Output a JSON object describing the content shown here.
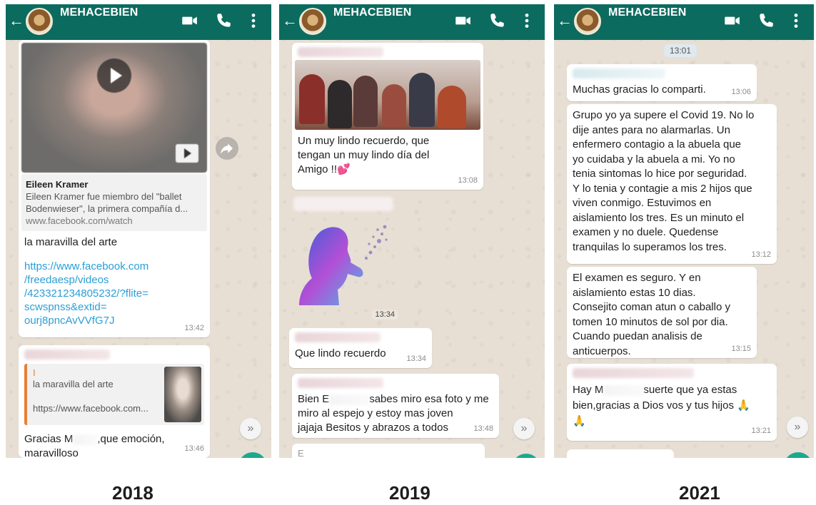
{
  "app": {
    "chat_title": "MEHACEBIEN"
  },
  "icons": {
    "back": "arrow-left-icon",
    "video": "video-call-icon",
    "call": "phone-icon",
    "menu": "more-vert-icon",
    "scroll": "double-chevron-down-icon"
  },
  "colors": {
    "header": "#0c6b5f",
    "chat_bg": "#e7dfd4",
    "link": "#2a9fd6"
  },
  "years": [
    "2018",
    "2019",
    "2021"
  ],
  "p2018": {
    "preview_title": "Eileen Kramer",
    "preview_desc_1": "Eileen Kramer fue miembro del \"ballet",
    "preview_desc_2": "Bodenwieser\", la primera compañía d...",
    "preview_url": "www.facebook.com/watch",
    "msg1_text": "la maravilla del arte",
    "msg1_link": [
      "https://www.facebook.com",
      "/freedaesp/videos",
      "/423321234805232/?flite=",
      "scwspnss&extid=",
      "ourj8pncAvVVfG7J"
    ],
    "msg1_time": "13:42",
    "quote_mark": "I",
    "quote_text": "la maravilla del arte",
    "quote_url": "https://www.facebook.com...",
    "msg2_a": "Gracias M",
    "msg2_b": ",que emoción,",
    "msg2_c": "maravilloso",
    "msg2_time": "13:46"
  },
  "p2019": {
    "msg1_lines": [
      "Un muy lindo recuerdo, que",
      "tengan un muy lindo día del",
      "Amigo !!💕"
    ],
    "msg1_time": "13:08",
    "sticker_time": "13:34",
    "msg2_text": "Que lindo recuerdo",
    "msg2_time": "13:34",
    "msg3_a": "Bien E",
    "msg3_b": "sabes miro esa foto y me",
    "msg3_c": "miro al espejo y estoy mas joven",
    "msg3_d": "jajaja Besitos y abrazos a todos",
    "msg3_time": "13:48",
    "peek": "E"
  },
  "p2021": {
    "top_time": "13:01",
    "msg1_text": "Muchas gracias lo comparti.",
    "msg1_time": "13:06",
    "msg2_lines": [
      "Grupo yo ya supere el Covid 19. No lo",
      "dije antes para no alarmarlas. Un",
      "enfermero contagio a la abuela que",
      "yo cuidaba y la abuela a mi. Yo no",
      "tenia sintomas lo hice por seguridad.",
      "Y lo tenia y contagie a mis 2 hijos que",
      "viven conmigo. Estuvimos en",
      "aislamiento los tres. Es un minuto el",
      "examen y no duele. Quedense",
      "tranquilas lo superamos los tres."
    ],
    "msg2_time": "13:12",
    "msg3_lines": [
      "El examen es seguro. Y en",
      "aislamiento estas 10 dias.",
      "Consejito coman atun o caballo y",
      "tomen 10 minutos de sol por dia.",
      "Cuando puedan analisis de",
      "anticuerpos."
    ],
    "msg3_time": "13:15",
    "msg4_a": "Hay M",
    "msg4_b": "suerte que ya estas",
    "msg4_c": "bien,gracias a Dios vos y tus hijos 🙏",
    "msg4_d": "🙏",
    "msg4_time": "13:21"
  }
}
